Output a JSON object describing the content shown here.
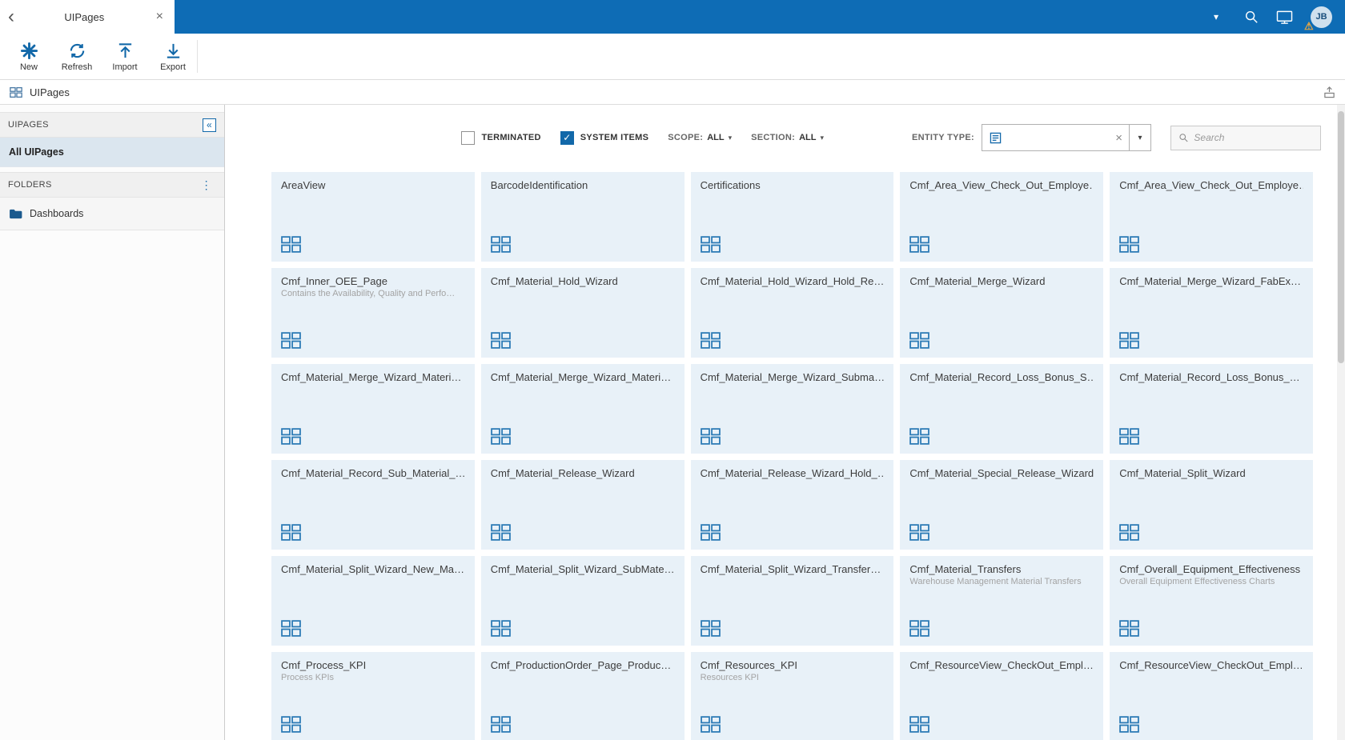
{
  "colors": {
    "topbar_blue": "#0e6cb5",
    "accent_blue": "#1268a9",
    "tile_background": "#e8f1f8",
    "selected_item_background": "#dbe6ef",
    "warning_orange": "#eda73f"
  },
  "icons": {
    "back": "‹",
    "close": "×",
    "caret_down": "▾",
    "dots_menu": "⋮",
    "collapse_panel": "«",
    "clear": "×",
    "check": "✓",
    "warning": "⚠"
  },
  "topbar": {
    "tab_title": "UIPages",
    "avatar_initials": "JB"
  },
  "toolbar": {
    "buttons": [
      {
        "label": "New"
      },
      {
        "label": "Refresh"
      },
      {
        "label": "Import"
      },
      {
        "label": "Export"
      }
    ]
  },
  "breadcrumb": {
    "title": "UIPages"
  },
  "sidebar": {
    "uipages_header": "UIPAGES",
    "all_uipages_label": "All UIPages",
    "folders_header": "FOLDERS",
    "folder_items": [
      {
        "label": "Dashboards"
      }
    ]
  },
  "filters": {
    "terminated": {
      "label": "TERMINATED",
      "checked": false
    },
    "system_items": {
      "label": "SYSTEM ITEMS",
      "checked": true
    },
    "scope_label": "SCOPE:",
    "scope_value": "ALL",
    "section_label": "SECTION:",
    "section_value": "ALL",
    "entity_type_label": "ENTITY TYPE:",
    "search_placeholder": "Search"
  },
  "tiles": [
    {
      "title": "AreaView",
      "description": ""
    },
    {
      "title": "BarcodeIdentification",
      "description": ""
    },
    {
      "title": "Certifications",
      "description": ""
    },
    {
      "title": "Cmf_Area_View_Check_Out_Employe…",
      "description": ""
    },
    {
      "title": "Cmf_Area_View_Check_Out_Employe…",
      "description": ""
    },
    {
      "title": "Cmf_Inner_OEE_Page",
      "description": "Contains the Availability, Quality and Perfo…"
    },
    {
      "title": "Cmf_Material_Hold_Wizard",
      "description": ""
    },
    {
      "title": "Cmf_Material_Hold_Wizard_Hold_Re…",
      "description": ""
    },
    {
      "title": "Cmf_Material_Merge_Wizard",
      "description": ""
    },
    {
      "title": "Cmf_Material_Merge_Wizard_FabEx…",
      "description": ""
    },
    {
      "title": "Cmf_Material_Merge_Wizard_Materi…",
      "description": ""
    },
    {
      "title": "Cmf_Material_Merge_Wizard_Materi…",
      "description": ""
    },
    {
      "title": "Cmf_Material_Merge_Wizard_Subma…",
      "description": ""
    },
    {
      "title": "Cmf_Material_Record_Loss_Bonus_S…",
      "description": ""
    },
    {
      "title": "Cmf_Material_Record_Loss_Bonus_…",
      "description": ""
    },
    {
      "title": "Cmf_Material_Record_Sub_Material_…",
      "description": ""
    },
    {
      "title": "Cmf_Material_Release_Wizard",
      "description": ""
    },
    {
      "title": "Cmf_Material_Release_Wizard_Hold_…",
      "description": ""
    },
    {
      "title": "Cmf_Material_Special_Release_Wizard",
      "description": ""
    },
    {
      "title": "Cmf_Material_Split_Wizard",
      "description": ""
    },
    {
      "title": "Cmf_Material_Split_Wizard_New_Ma…",
      "description": ""
    },
    {
      "title": "Cmf_Material_Split_Wizard_SubMate…",
      "description": ""
    },
    {
      "title": "Cmf_Material_Split_Wizard_Transfer…",
      "description": ""
    },
    {
      "title": "Cmf_Material_Transfers",
      "description": "Warehouse Management Material Transfers"
    },
    {
      "title": "Cmf_Overall_Equipment_Effectiveness",
      "description": "Overall Equipment Effectiveness Charts"
    },
    {
      "title": "Cmf_Process_KPI",
      "description": "Process KPIs"
    },
    {
      "title": "Cmf_ProductionOrder_Page_Produc…",
      "description": ""
    },
    {
      "title": "Cmf_Resources_KPI",
      "description": "Resources KPI"
    },
    {
      "title": "Cmf_ResourceView_CheckOut_Empl…",
      "description": ""
    },
    {
      "title": "Cmf_ResourceView_CheckOut_Empl…",
      "description": ""
    }
  ]
}
